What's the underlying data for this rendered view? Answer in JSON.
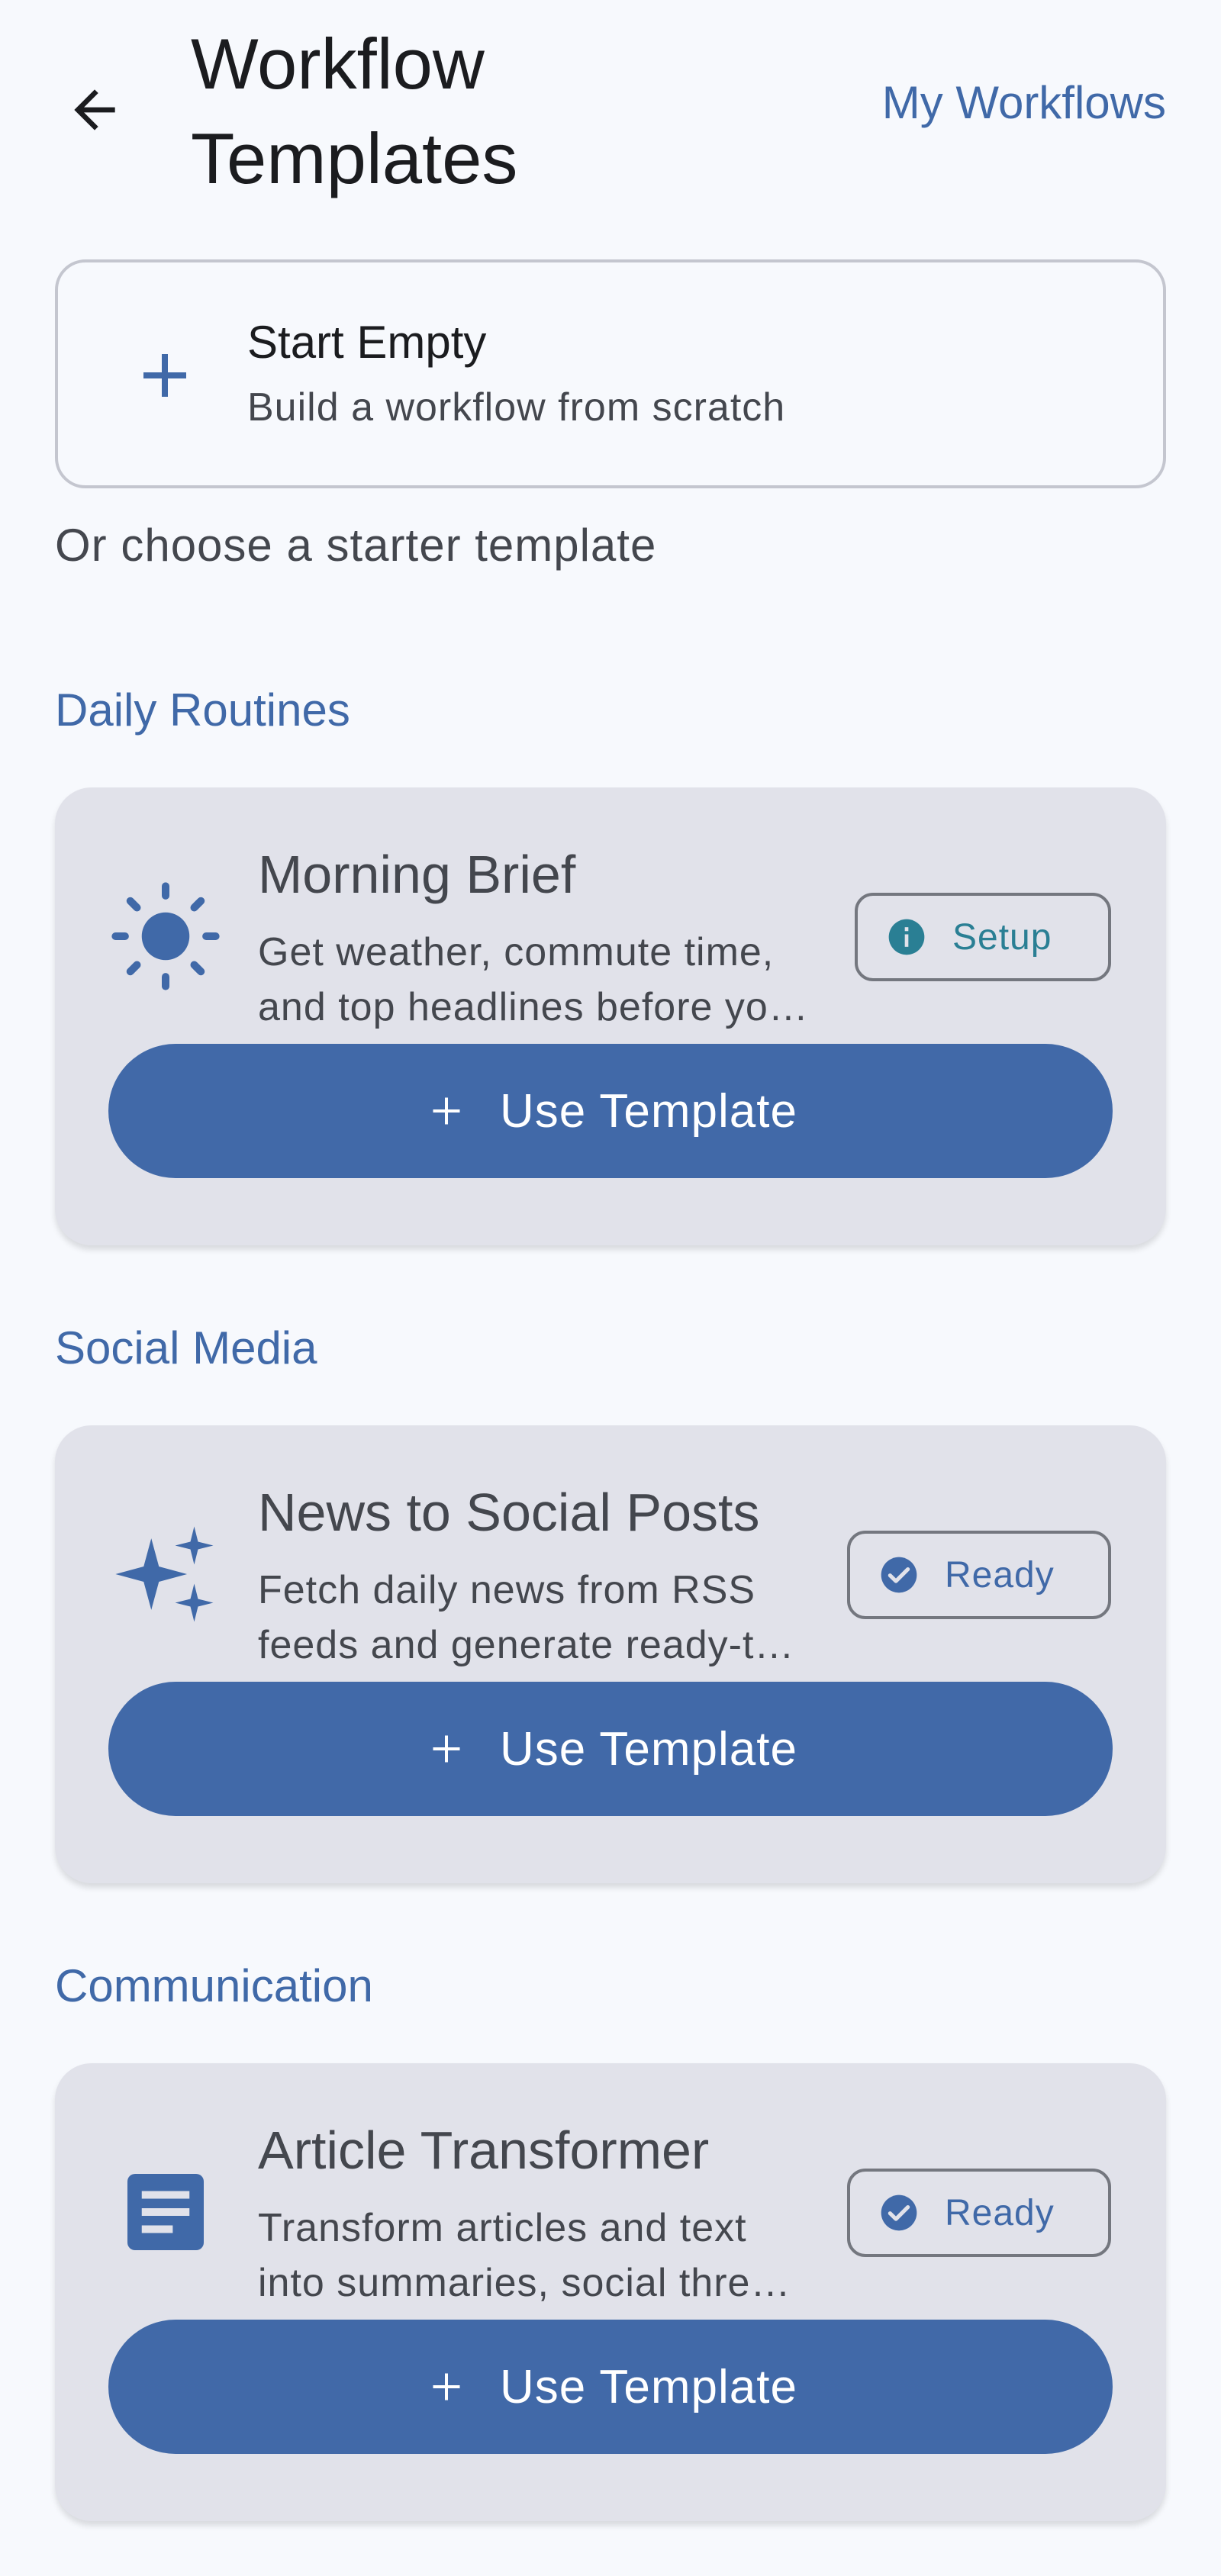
{
  "header": {
    "title_line1": "Workflow",
    "title_line2": "Templates",
    "my_workflows_label": "My Workflows",
    "back_icon": "arrow-left-icon"
  },
  "start_empty": {
    "title": "Start Empty",
    "subtitle": "Build a workflow from scratch",
    "icon": "plus-icon"
  },
  "or_choose_label": "Or choose a starter template",
  "sections": [
    {
      "title": "Daily Routines",
      "card": {
        "icon": "sun-icon",
        "title": "Morning Brief",
        "desc_line1": "Get weather, commute time,",
        "desc_line2": "and top headlines before yo…",
        "badge_label": "Setup",
        "badge_icon": "info-icon",
        "button_label": "Use Template"
      }
    },
    {
      "title": "Social Media",
      "card": {
        "icon": "sparkles-icon",
        "title": "News to Social Posts",
        "desc_line1": "Fetch daily news from RSS",
        "desc_line2": "feeds and generate ready-t…",
        "badge_label": "Ready",
        "badge_icon": "check-circle-icon",
        "button_label": "Use Template"
      }
    },
    {
      "title": "Communication",
      "card": {
        "icon": "article-icon",
        "title": "Article Transformer",
        "desc_line1": "Transform articles and text",
        "desc_line2": "into summaries, social thre…",
        "badge_label": "Ready",
        "badge_icon": "check-circle-icon",
        "button_label": "Use Template"
      }
    }
  ],
  "colors": {
    "background": "#f7f9fd",
    "accent": "#4069a8",
    "card_bg": "#e1e2ea",
    "setup_teal": "#2a7f94"
  }
}
